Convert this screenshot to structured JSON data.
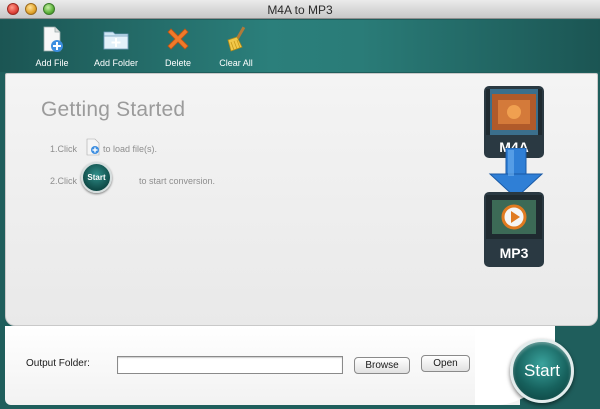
{
  "window": {
    "title": "M4A to MP3"
  },
  "toolbar": {
    "add_file": "Add File",
    "add_folder": "Add Folder",
    "delete": "Delete",
    "clear_all": "Clear All"
  },
  "main": {
    "heading": "Getting Started",
    "step1_pre": "1.Click",
    "step1_post": "to load file(s).",
    "step2_pre": "2.Click",
    "step2_icon_label": "Start",
    "step2_post": "to start conversion.",
    "source_format": "M4A",
    "target_format": "MP3"
  },
  "bottom": {
    "output_label": "Output Folder:",
    "output_value": "",
    "browse_label": "Browse",
    "open_label": "Open",
    "start_label": "Start"
  },
  "colors": {
    "toolbar": "#2b7f7b",
    "accent": "#17625e",
    "arrow": "#2f7fd6"
  },
  "icons": [
    "add-file-icon",
    "add-folder-icon",
    "delete-icon",
    "clear-all-icon",
    "add-file-small-icon",
    "start-icon",
    "arrow-down-icon"
  ]
}
